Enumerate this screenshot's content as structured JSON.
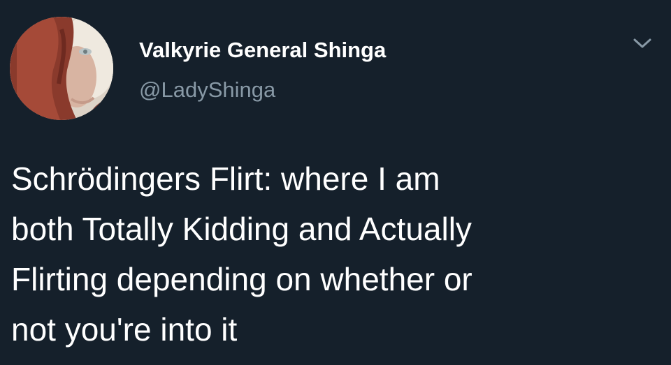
{
  "author": {
    "display_name": "Valkyrie General Shinga",
    "handle": "@LadyShinga",
    "avatar_icon": "profile-photo"
  },
  "menu": {
    "icon": "chevron-down-icon"
  },
  "tweet": {
    "lines": [
      "Schrödingers Flirt: where I am",
      "both Totally Kidding and Actually",
      "Flirting depending on whether or",
      "not you're into it"
    ]
  },
  "colors": {
    "background": "#15202b",
    "primary_text": "#ffffff",
    "secondary_text": "#8899a6"
  }
}
